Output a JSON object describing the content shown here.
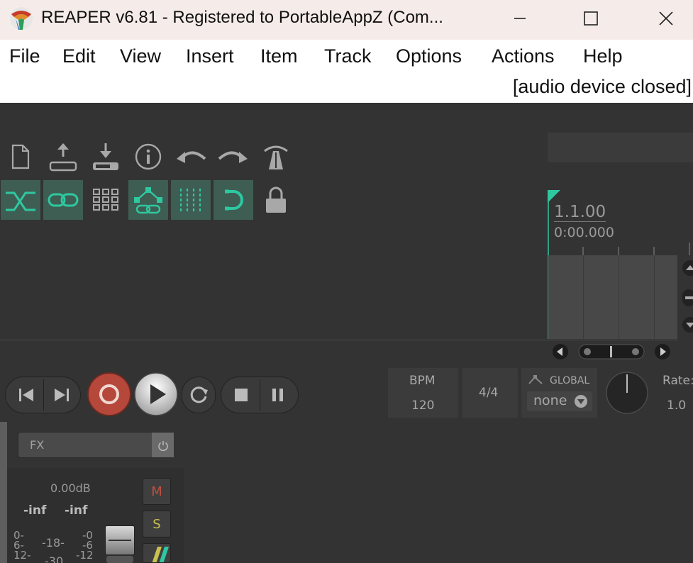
{
  "window": {
    "title": "REAPER v6.81 - Registered to PortableAppZ (Com..."
  },
  "menu": {
    "items": [
      "File",
      "Edit",
      "View",
      "Insert",
      "Item",
      "Track",
      "Options",
      "Actions",
      "Help"
    ],
    "audio_status": "[audio device closed]"
  },
  "colors": {
    "accent": "#2ec8a0",
    "toggle_bg": "#3e5e53",
    "record": "#b5483a"
  },
  "toolbar": {
    "row1_icons": [
      "new-project-icon",
      "save-project-icon",
      "open-project-icon",
      "project-info-icon",
      "undo-icon",
      "redo-icon",
      "metronome-icon"
    ],
    "row2_icons": [
      "auto-crossfade-icon",
      "ripple-edit-icon",
      "grid-icon",
      "envelope-link-icon",
      "snap-grid-icon",
      "snap-icon",
      "lock-icon"
    ]
  },
  "timeline": {
    "position_beats": "1.1.00",
    "position_time": "0:00.000"
  },
  "transport": {
    "bpm_label": "BPM",
    "bpm_value": "120",
    "time_signature": "4/4",
    "automation_label": "GLOBAL",
    "automation_mode": "none",
    "rate_label": "Rate:",
    "rate_value": "1.0"
  },
  "mixer": {
    "fx_label": "FX",
    "volume": "0.00dB",
    "peak_left": "-inf",
    "peak_right": "-inf",
    "mute_label": "M",
    "solo_label": "S",
    "scale_left": [
      "0-",
      "6-",
      "12-"
    ],
    "scale_mid": [
      "-18-",
      "-30"
    ],
    "scale_right": [
      "-0",
      "-6",
      "-12"
    ]
  }
}
